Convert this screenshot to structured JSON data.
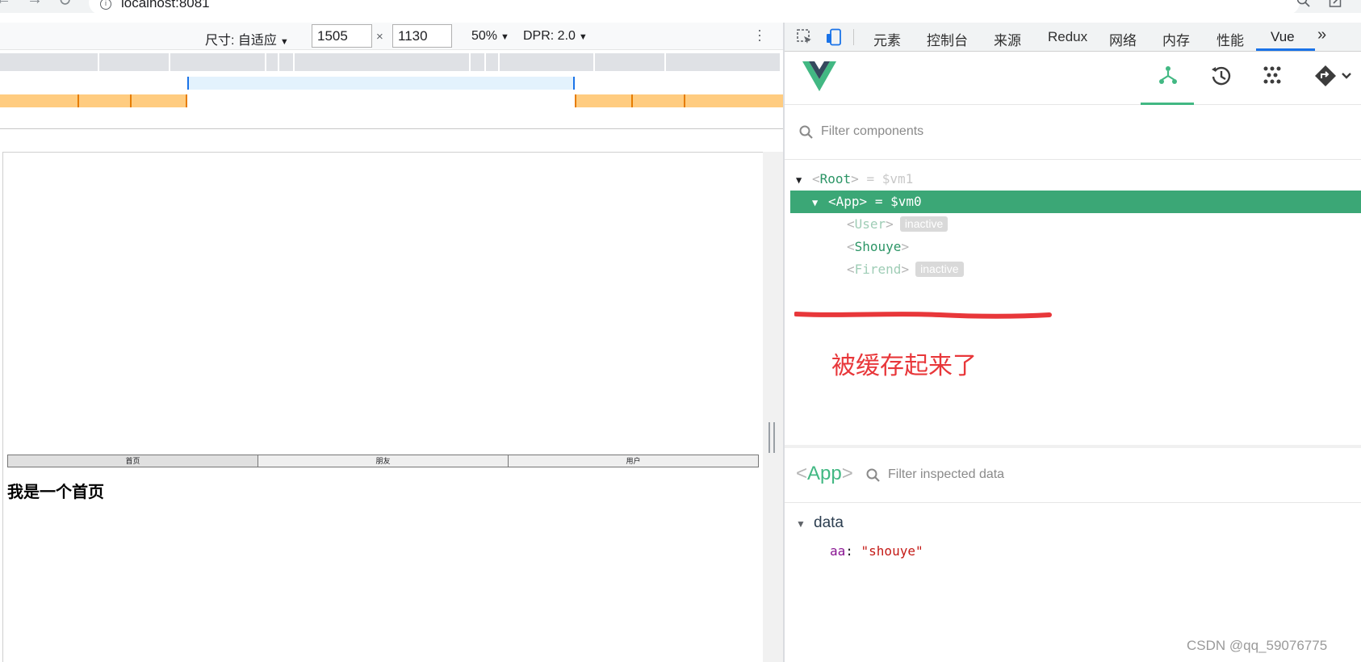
{
  "browser": {
    "url": "localhost:8081"
  },
  "device_toolbar": {
    "dimensions_label": "尺寸: 自适应",
    "width": "1505",
    "height": "1130",
    "times": "×",
    "zoom": "50%",
    "dpr": "DPR: 2.0"
  },
  "page": {
    "tabs": [
      "首页",
      "朋友",
      "用户"
    ],
    "heading": "我是一个首页"
  },
  "devtools": {
    "tabs": [
      "元素",
      "控制台",
      "来源",
      "Redux",
      "网络",
      "内存",
      "性能",
      "Vue"
    ],
    "active_tab": "Vue",
    "more": "»"
  },
  "vue": {
    "filter_placeholder": "Filter components",
    "tree": {
      "root": {
        "name": "Root",
        "vm": "= $vm1"
      },
      "app": {
        "name": "App",
        "vm": "= $vm0"
      },
      "children": [
        {
          "name": "User",
          "badge": "inactive"
        },
        {
          "name": "Shouye",
          "badge": ""
        },
        {
          "name": "Firend",
          "badge": "inactive"
        }
      ]
    },
    "annotation": "被缓存起来了",
    "inspector": {
      "component": "App",
      "filter_placeholder": "Filter inspected data",
      "section": "data",
      "props": [
        {
          "key": "aa",
          "value": "\"shouye\""
        }
      ]
    }
  },
  "watermark": "CSDN @qq_59076775",
  "colors": {
    "vue_green": "#42b883",
    "selected_row": "#3ba776",
    "annotation_red": "#e8373a",
    "active_tab_blue": "#1a73e8"
  }
}
